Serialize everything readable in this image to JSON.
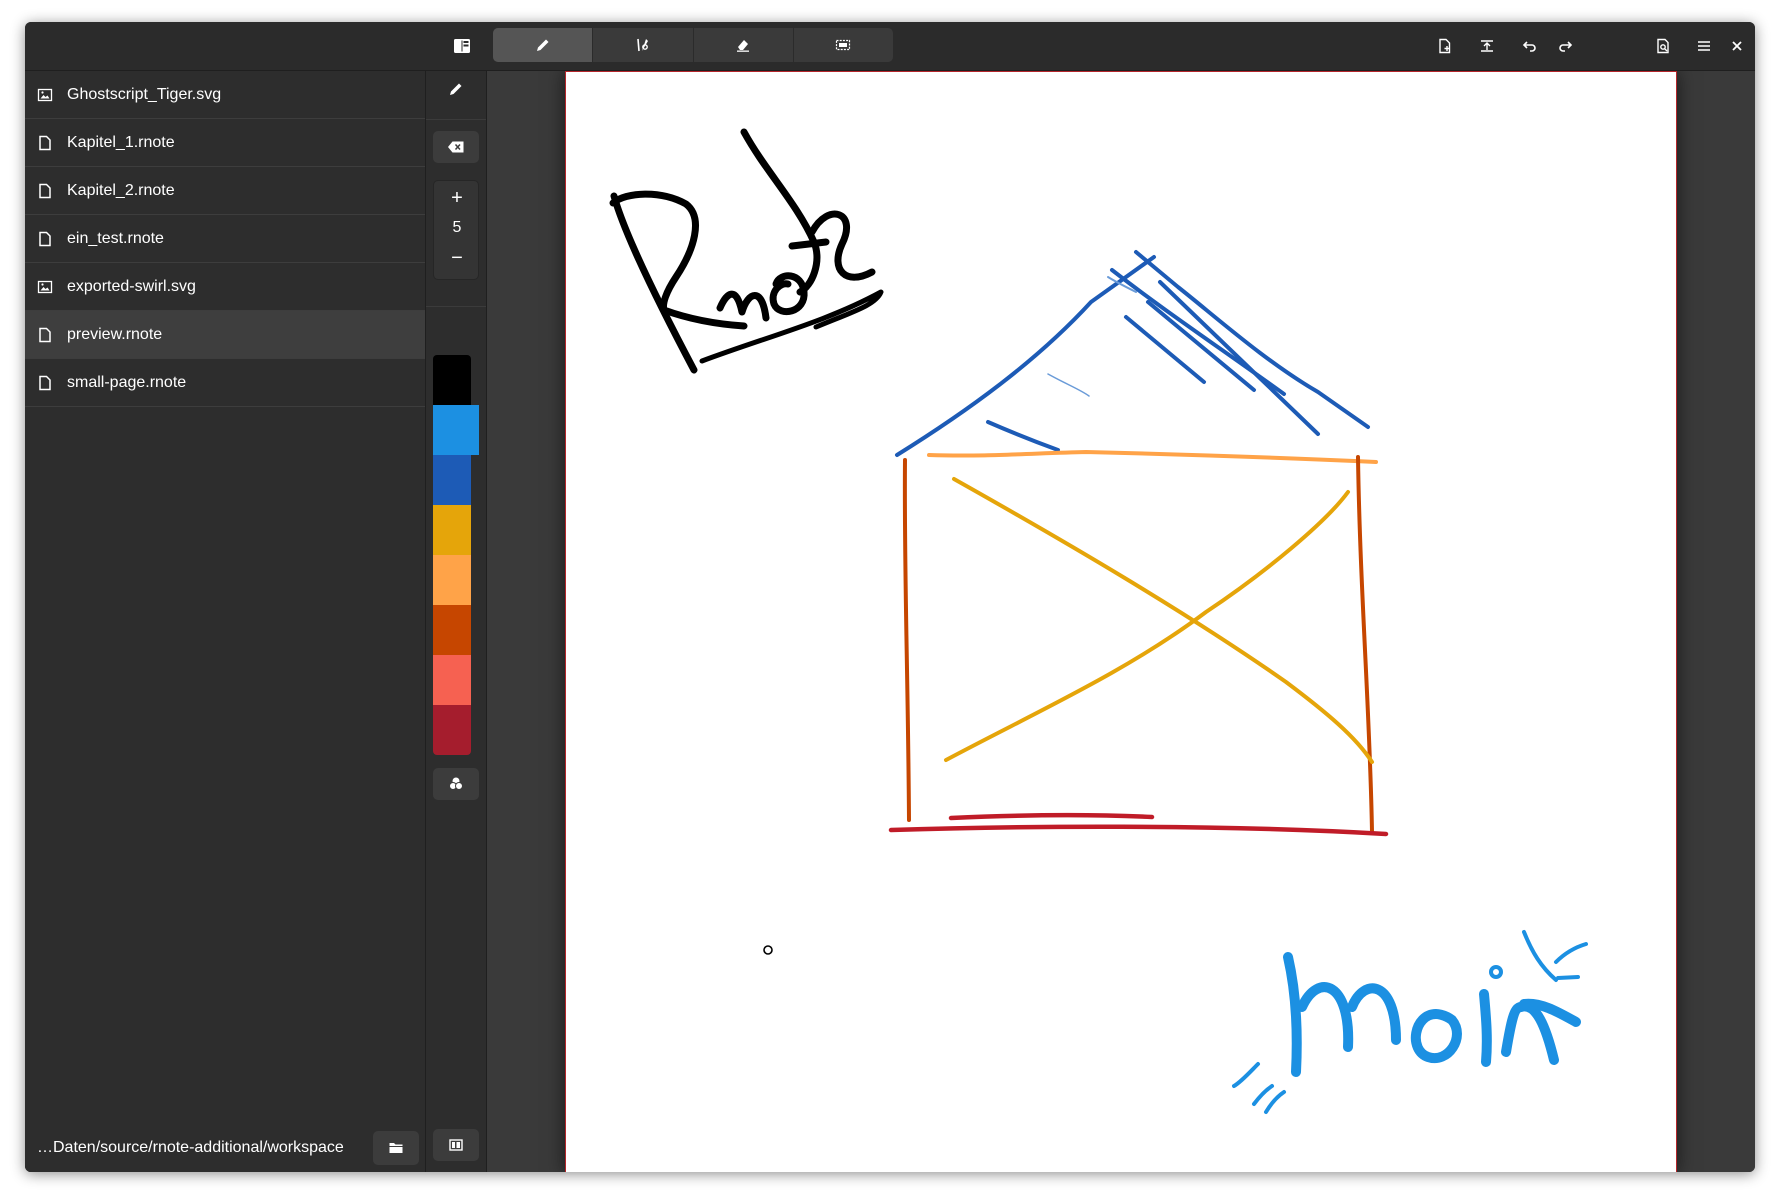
{
  "headerbar": {
    "sidebar_toggle_icon": "sidebar-icon",
    "tools": [
      {
        "name": "pen",
        "icon": "pencil-icon",
        "active": true
      },
      {
        "name": "shaper",
        "icon": "shaper-icon",
        "active": false
      },
      {
        "name": "eraser",
        "icon": "eraser-icon",
        "active": false
      },
      {
        "name": "selector",
        "icon": "selector-icon",
        "active": false
      }
    ],
    "actions": [
      "new-document-icon",
      "import-icon",
      "undo-icon",
      "redo-icon",
      "document-settings-icon",
      "menu-icon",
      "close-icon"
    ]
  },
  "sidebar": {
    "files": [
      {
        "name": "Ghostscript_Tiger.svg",
        "type": "image"
      },
      {
        "name": "Kapitel_1.rnote",
        "type": "document"
      },
      {
        "name": "Kapitel_2.rnote",
        "type": "document"
      },
      {
        "name": "ein_test.rnote",
        "type": "document"
      },
      {
        "name": "exported-swirl.svg",
        "type": "image"
      },
      {
        "name": "preview.rnote",
        "type": "document",
        "selected": true
      },
      {
        "name": "small-page.rnote",
        "type": "document"
      }
    ],
    "footer_path": "…Daten/source/rnote-additional/workspace"
  },
  "toolcol": {
    "size_plus": "+",
    "size_value": "5",
    "size_minus": "−",
    "colors": [
      "#000000",
      "#1c90e2",
      "#1d5bb6",
      "#e5a50a",
      "#ffa348",
      "#c64600",
      "#f66151",
      "#a51d2d"
    ],
    "selected_color_index": 1
  },
  "canvas": {
    "page_border_color": "#b4262b",
    "drawing": {
      "handwriting_text": "Rnote",
      "handwriting_text_2": "moin"
    }
  }
}
